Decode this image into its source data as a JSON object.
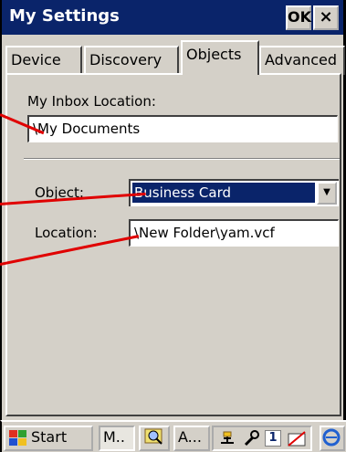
{
  "window": {
    "title": "My Settings",
    "ok_label": "OK",
    "close_label": "×"
  },
  "tabs": [
    {
      "label": "Device"
    },
    {
      "label": "Discovery"
    },
    {
      "label": "Objects",
      "active": true
    },
    {
      "label": "Advanced"
    }
  ],
  "form": {
    "inbox_label": "My Inbox Location:",
    "inbox_value": "\\My Documents",
    "object_label": "Object:",
    "object_value": "Business Card",
    "location_label": "Location:",
    "location_value": "\\New Folder\\yam.vcf"
  },
  "taskbar": {
    "start_label": "Start",
    "app1_label": "M..",
    "app3_label": "A...",
    "tray_number": "1"
  },
  "colors": {
    "titlebar": "#0a246a",
    "selection": "#0a246a",
    "callout": "#e00000",
    "dialog": "#d4d0c8"
  }
}
